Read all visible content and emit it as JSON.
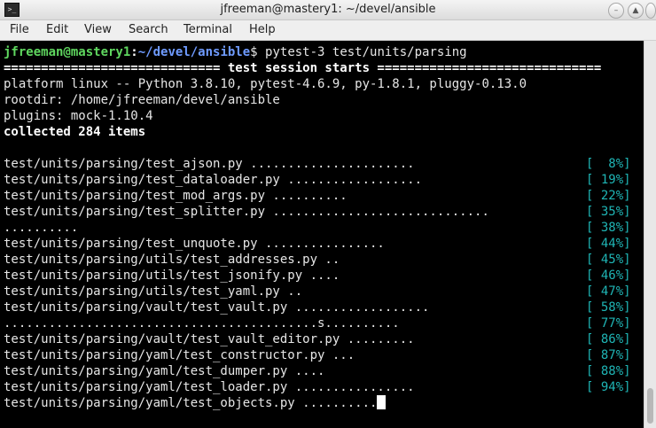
{
  "window": {
    "title": "jfreeman@mastery1: ~/devel/ansible",
    "icon": "terminal-icon"
  },
  "menu": [
    "File",
    "Edit",
    "View",
    "Search",
    "Terminal",
    "Help"
  ],
  "prompt": {
    "user_host": "jfreeman@mastery1",
    "sep": ":",
    "path": "~/devel/ansible",
    "symbol": "$ ",
    "command": "pytest-3 test/units/parsing"
  },
  "session_header": "============================= test session starts ==============================",
  "info_lines": [
    "platform linux -- Python 3.8.10, pytest-4.6.9, py-1.8.1, pluggy-0.13.0",
    "rootdir: /home/jfreeman/devel/ansible",
    "plugins: mock-1.10.4"
  ],
  "collected": "collected 284 items",
  "results": [
    {
      "text": "test/units/parsing/test_ajson.py ......................",
      "pct": "[  8%]"
    },
    {
      "text": "test/units/parsing/test_dataloader.py ..................",
      "pct": "[ 19%]"
    },
    {
      "text": "test/units/parsing/test_mod_args.py ..........",
      "pct": "[ 22%]"
    },
    {
      "text": "test/units/parsing/test_splitter.py .............................",
      "pct": "[ 35%]"
    },
    {
      "text": "..........",
      "pct": "[ 38%]"
    },
    {
      "text": "test/units/parsing/test_unquote.py ................",
      "pct": "[ 44%]"
    },
    {
      "text": "test/units/parsing/utils/test_addresses.py ..",
      "pct": "[ 45%]"
    },
    {
      "text": "test/units/parsing/utils/test_jsonify.py ....",
      "pct": "[ 46%]"
    },
    {
      "text": "test/units/parsing/utils/test_yaml.py ..",
      "pct": "[ 47%]"
    },
    {
      "text": "test/units/parsing/vault/test_vault.py ..................",
      "pct": "[ 58%]"
    },
    {
      "text": "..........................................s..........",
      "pct": "[ 77%]"
    },
    {
      "text": "test/units/parsing/vault/test_vault_editor.py .........",
      "pct": "[ 86%]"
    },
    {
      "text": "test/units/parsing/yaml/test_constructor.py ...",
      "pct": "[ 87%]"
    },
    {
      "text": "test/units/parsing/yaml/test_dumper.py ....",
      "pct": "[ 88%]"
    },
    {
      "text": "test/units/parsing/yaml/test_loader.py ................",
      "pct": "[ 94%]"
    }
  ],
  "current_line": "test/units/parsing/yaml/test_objects.py ..........",
  "colors": {
    "prompt_user": "#5fd75f",
    "prompt_path": "#6f9bff",
    "percent": "#1fb5b5",
    "terminal_bg": "#000000"
  }
}
